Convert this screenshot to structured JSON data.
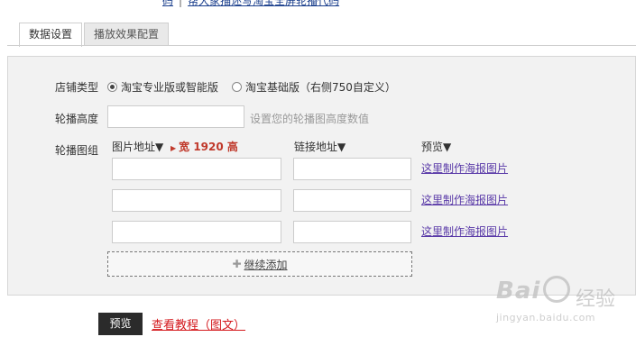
{
  "top_strip": {
    "left_text": "码",
    "right_text": "帮大家描述写淘宝全屏轮播代码"
  },
  "tabs": [
    {
      "label": "数据设置",
      "active": true
    },
    {
      "label": "播放效果配置",
      "active": false
    }
  ],
  "form": {
    "store_type": {
      "label": "店铺类型",
      "options": [
        {
          "label": "淘宝专业版或智能版",
          "checked": true
        },
        {
          "label": "淘宝基础版（右侧750自定义）",
          "checked": false
        }
      ]
    },
    "height": {
      "label": "轮播高度",
      "value": "",
      "hint": "设置您的轮播图高度数值"
    },
    "group": {
      "label": "轮播图组",
      "col_image": "图片地址▼",
      "col_warning": "宽 1920 高",
      "col_link": "链接地址▼",
      "col_preview": "预览▼",
      "rows": [
        {
          "image_url": "",
          "link_url": "",
          "poster_link": "这里制作海报图片"
        },
        {
          "image_url": "",
          "link_url": "",
          "poster_link": "这里制作海报图片"
        },
        {
          "image_url": "",
          "link_url": "",
          "poster_link": "这里制作海报图片"
        }
      ],
      "add_more_label": "继续添加"
    }
  },
  "footer": {
    "preview_button": "预览",
    "tutorial_link": "查看教程（图文）"
  },
  "watermark": {
    "logo": "Bai",
    "cn": "经验",
    "url": "jingyan.baidu.com"
  },
  "colors": {
    "panel_bg": "#f2f2f2",
    "poster_link": "#5a3aa8",
    "tutorial_link": "#d4181d",
    "warning": "#c0392b",
    "preview_button_bg": "#2b2b2b"
  }
}
